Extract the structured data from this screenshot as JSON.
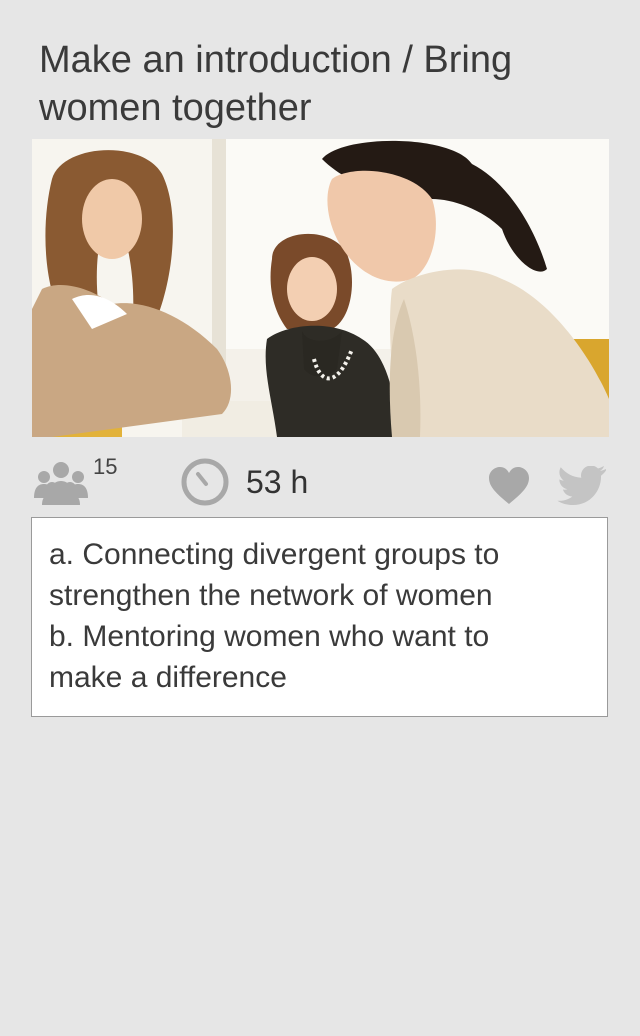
{
  "card": {
    "title": "Make an introduction / Bring women together",
    "image_alt": "Three women working together at a desk",
    "stats": {
      "participants_icon": "people-group-icon",
      "participants_count": "15",
      "time_icon": "clock-icon",
      "time_left": "53 h"
    },
    "actions": {
      "like_icon": "heart-icon",
      "share_icon": "twitter-bird-icon"
    },
    "description": [
      "a. Connecting divergent groups to",
      "strengthen the network of women",
      "b. Mentoring women who want to",
      "make a difference"
    ]
  },
  "colors": {
    "background": "#e6e6e6",
    "icon_gray": "#a8a8a8",
    "text_dark": "#333333",
    "box_border": "#9a9a9a"
  }
}
